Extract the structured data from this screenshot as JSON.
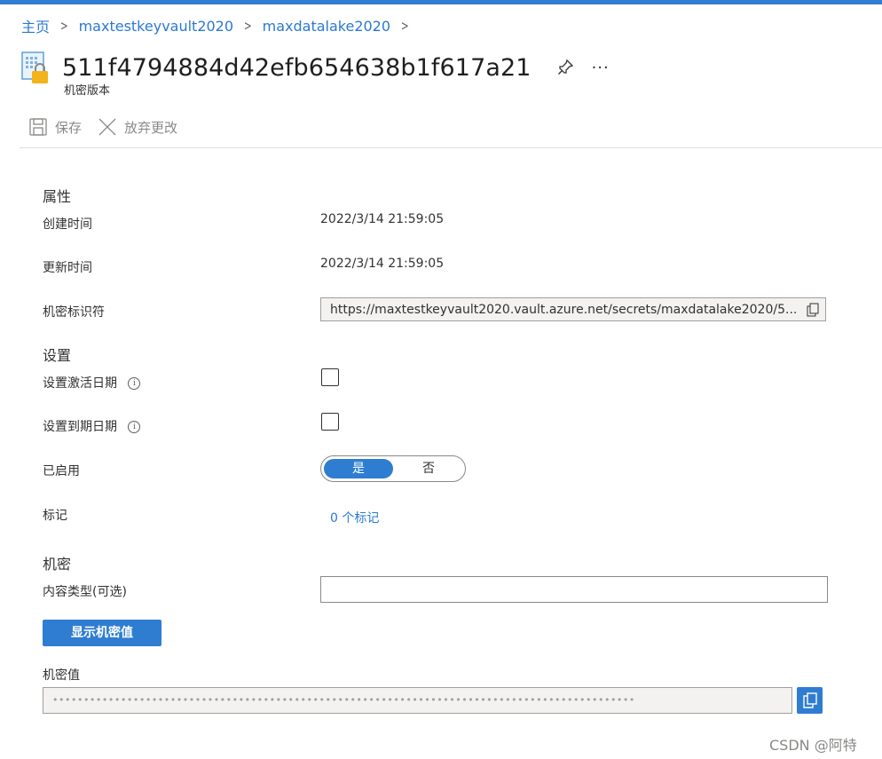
{
  "breadcrumb": {
    "items": [
      "主页",
      "maxtestkeyvault2020",
      "maxdatalake2020"
    ],
    "separator": ">"
  },
  "header": {
    "title": "511f4794884d42efb654638b1f617a21",
    "subtitle": "机密版本",
    "more": "···"
  },
  "toolbar": {
    "save_label": "保存",
    "discard_label": "放弃更改"
  },
  "properties": {
    "section_title": "属性",
    "created_label": "创建时间",
    "created_value": "2022/3/14 21:59:05",
    "updated_label": "更新时间",
    "updated_value": "2022/3/14 21:59:05",
    "identifier_label": "机密标识符",
    "identifier_value": "https://maxtestkeyvault2020.vault.azure.net/secrets/maxdatalake2020/5..."
  },
  "settings": {
    "section_title": "设置",
    "activation_label": "设置激活日期",
    "activation_checked": false,
    "expiration_label": "设置到期日期",
    "expiration_checked": false,
    "info_glyph": "i",
    "enabled_label": "已启用",
    "enabled_yes": "是",
    "enabled_no": "否",
    "enabled_value": "是",
    "tags_label": "标记",
    "tags_link": "0 个标记"
  },
  "secret": {
    "section_title": "机密",
    "content_type_label": "内容类型(可选)",
    "content_type_value": "",
    "show_button": "显示机密值",
    "value_label": "机密值",
    "masked_value": "••••••••••••••••••••••••••••••••••••••••••••••••••••••••••••••••••••••••••••••••••••••••••••••"
  },
  "watermark": "CSDN @阿特",
  "colors": {
    "accent": "#2f7dd1",
    "link": "#2b78d4",
    "text": "#323130",
    "disabled": "#8a8886"
  }
}
